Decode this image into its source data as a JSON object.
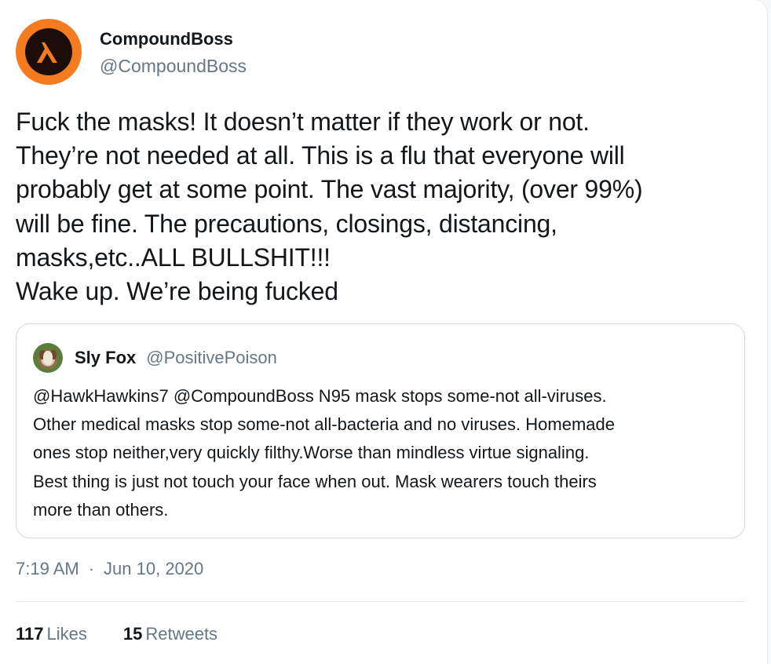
{
  "tweet": {
    "author": {
      "display_name": "CompoundBoss",
      "handle": "@CompoundBoss",
      "avatar_icon": "half-life-lambda-logo",
      "avatar_color": "#f47b20"
    },
    "text": "Fuck the masks! It doesn’t matter if they work or not.\nThey’re not needed at all. This is a flu that everyone will\nprobably get at some point. The vast majority, (over 99%)\nwill be fine. The precautions, closings, distancing,\nmasks,etc..ALL BULLSHIT!!!\nWake up. We’re being fucked",
    "quoted": {
      "display_name": "Sly Fox",
      "handle": "@PositivePoison",
      "avatar_icon": "dog-photo",
      "text": "@HawkHawkins7 @CompoundBoss N95 mask stops some-not all-viruses.\nOther medical masks stop some-not all-bacteria and no viruses. Homemade\nones stop neither,very quickly filthy.Worse than mindless virtue signaling.\nBest thing is just not touch your face when out. Mask wearers touch theirs\nmore than others."
    },
    "time": "7:19 AM",
    "separator": "·",
    "date": "Jun 10, 2020",
    "likes": {
      "count": "117",
      "label": "Likes"
    },
    "retweets": {
      "count": "15",
      "label": "Retweets"
    }
  }
}
